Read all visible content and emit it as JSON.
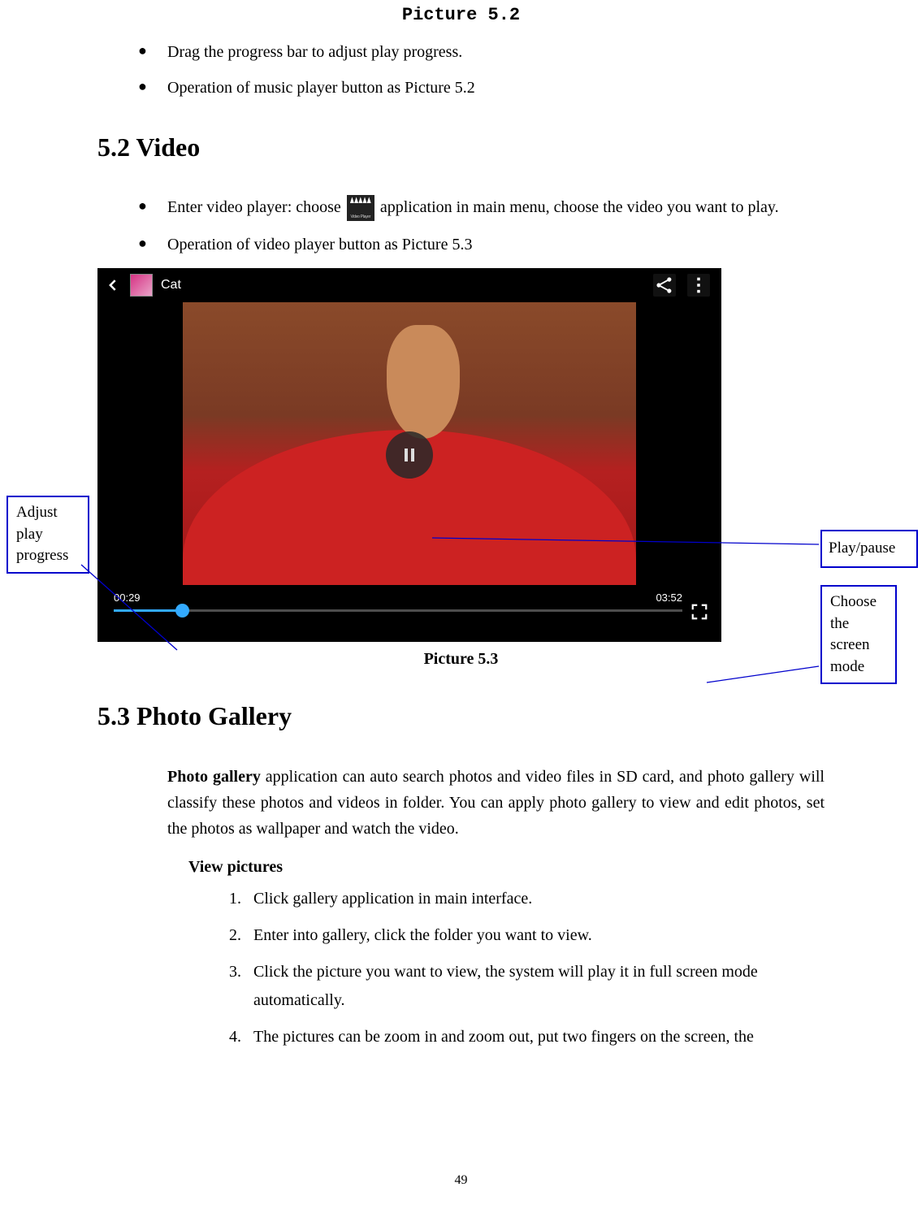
{
  "picture_top_label": "Picture 5.2",
  "bullets_top": {
    "b1": "Drag the progress bar to adjust play progress.",
    "b2": "Operation of music player button as Picture 5.2"
  },
  "h_video": "5.2 Video",
  "video_bullets": {
    "b1_pre": "Enter video player: choose ",
    "b1_post": "application in main menu, choose the video you want to play.",
    "b2": "Operation of video player button as Picture 5.3"
  },
  "player": {
    "title": "Cat",
    "time_current": "00:29",
    "time_total": "03:52"
  },
  "callouts": {
    "adjust_progress": "Adjust play progress",
    "play_pause": "Play/pause",
    "screen_mode": "Choose the screen mode"
  },
  "caption_53": "Picture 5.3",
  "h_gallery": "5.3 Photo Gallery",
  "gallery_para_pre_bold": "Photo gallery",
  "gallery_para_rest": " application can auto search photos and video files in SD card, and photo gallery will classify these photos and videos in folder. You can apply photo gallery to view and edit photos, set the photos as wallpaper and watch the video.",
  "view_pictures_label": "View pictures",
  "steps": {
    "s1": "Click gallery application in main interface.",
    "s2": "Enter into gallery, click the folder you want to view.",
    "s3": "Click the picture you want to view, the system will play it in full screen mode automatically.",
    "s4": "The pictures can be zoom in and zoom out, put two fingers on the screen, the"
  },
  "page_number": "49"
}
